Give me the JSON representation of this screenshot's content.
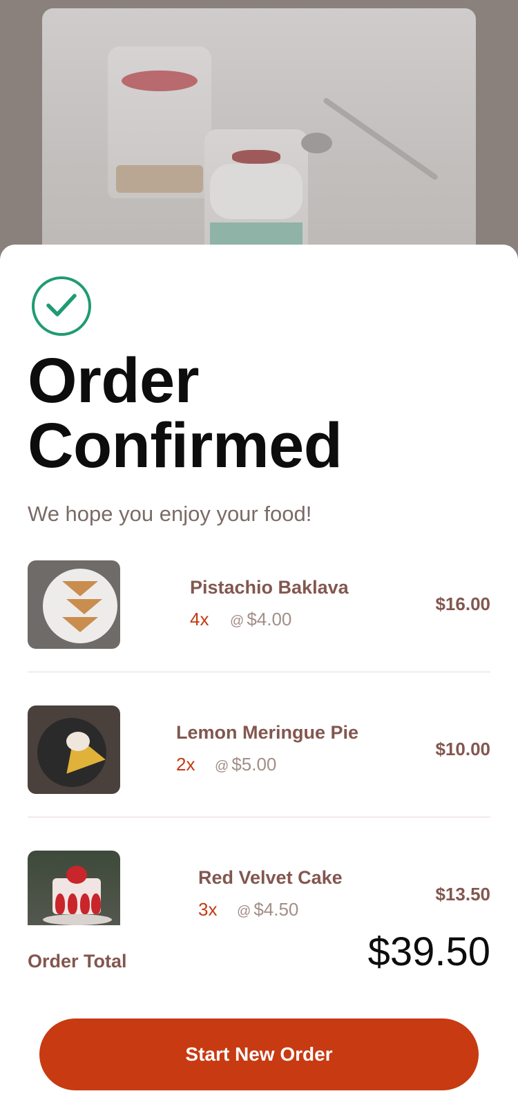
{
  "header": {
    "title": "Order Confirmed",
    "subtitle": "We hope you enjoy your food!"
  },
  "status_icon": "check-circle-icon",
  "items": [
    {
      "name": "Pistachio Baklava",
      "quantity": "4x",
      "unit_price": "$4.00",
      "total": "$16.00",
      "image": "baklava-thumbnail"
    },
    {
      "name": "Lemon Meringue Pie",
      "quantity": "2x",
      "unit_price": "$5.00",
      "total": "$10.00",
      "image": "lemon-pie-thumbnail"
    },
    {
      "name": "Red Velvet Cake",
      "quantity": "3x",
      "unit_price": "$4.50",
      "total": "$13.50",
      "image": "red-velvet-cake-thumbnail"
    }
  ],
  "at_symbol": "@",
  "order_total": {
    "label": "Order Total",
    "value": "$39.50"
  },
  "cta": {
    "label": "Start New Order"
  },
  "colors": {
    "accent": "#c73a12",
    "success": "#1f9b74",
    "brown_text": "#82574f",
    "title_text": "#0d0d0d"
  }
}
